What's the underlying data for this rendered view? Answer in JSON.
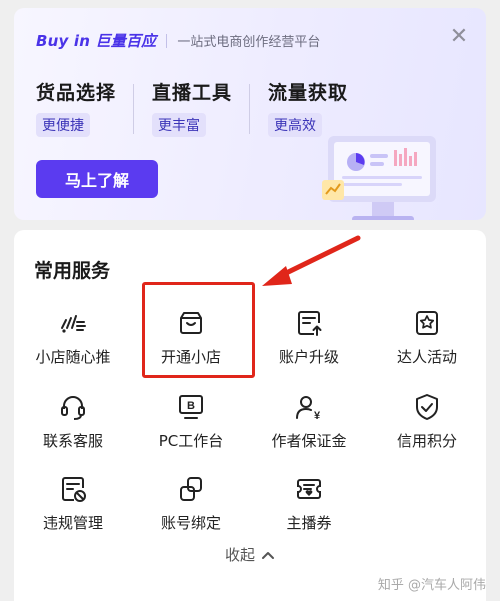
{
  "banner": {
    "brand": "Buy in 巨量百应",
    "slogan": "一站式电商创作经营平台",
    "close_icon": "close-icon",
    "features": [
      {
        "title": "货品选择",
        "tag": "更便捷"
      },
      {
        "title": "直播工具",
        "tag": "更丰富"
      },
      {
        "title": "流量获取",
        "tag": "更高效"
      }
    ],
    "cta": "马上了解"
  },
  "services": {
    "title": "常用服务",
    "items": [
      {
        "label": "小店随心推",
        "icon": "boost-icon"
      },
      {
        "label": "开通小店",
        "icon": "shop-icon"
      },
      {
        "label": "账户升级",
        "icon": "upgrade-icon"
      },
      {
        "label": "达人活动",
        "icon": "activity-icon"
      },
      {
        "label": "联系客服",
        "icon": "headset-icon"
      },
      {
        "label": "PC工作台",
        "icon": "pc-workbench-icon"
      },
      {
        "label": "作者保证金",
        "icon": "deposit-icon"
      },
      {
        "label": "信用积分",
        "icon": "shield-check-icon"
      },
      {
        "label": "违规管理",
        "icon": "violation-icon"
      },
      {
        "label": "账号绑定",
        "icon": "link-icon"
      },
      {
        "label": "主播券",
        "icon": "coupon-icon"
      }
    ],
    "collapse": "收起"
  },
  "annotation": {
    "color": "#e0261a"
  },
  "watermark": "知乎 @汽车人阿伟",
  "colors": {
    "accent": "#5b3bf0",
    "tag_bg": "#e3e0fb",
    "banner_bg": "#efedff"
  }
}
